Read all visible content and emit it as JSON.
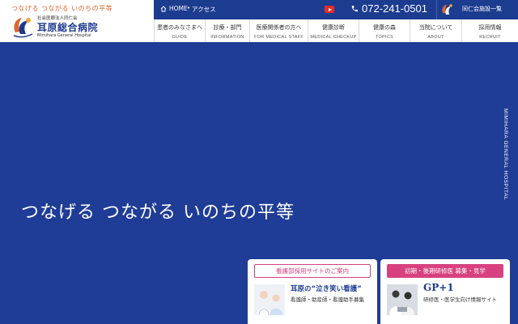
{
  "header": {
    "tagline": "つなげる つながる いのちの平等",
    "corp_name": "社会医療法人同仁会",
    "hospital_name": "耳原総合病院",
    "hospital_name_en": "Mimihara General Hospital"
  },
  "topbar": {
    "home_label": "HOME",
    "access_label": "アクセス",
    "phone": "072-241-0501",
    "group_label": "同仁会施設一覧"
  },
  "nav": [
    {
      "jp": "患者のみなさまへ",
      "en": "GUIDE"
    },
    {
      "jp": "診療・部門",
      "en": "INFORMATION"
    },
    {
      "jp": "医療関係者の方へ",
      "en": "FOR MEDICAL STAFF"
    },
    {
      "jp": "健康診断",
      "en": "MEDICAL CHECKUP"
    },
    {
      "jp": "健康の森",
      "en": "TOPICS"
    },
    {
      "jp": "当院について",
      "en": "ABOUT"
    },
    {
      "jp": "採用情報",
      "en": "RECRUIT"
    }
  ],
  "hero": {
    "title": "つなげる つながる いのちの平等",
    "vertical_label": "MIMIHARA GENERAL HOSPITAL"
  },
  "banners": {
    "nursing": {
      "head": "看護部採用サイトのご案内",
      "title": "耳原の“泣き笑い看護”",
      "sub": "看護師・助産師・看護助手募集"
    },
    "resident": {
      "head": "初期・後期研修医 募集・見学",
      "title": "GP+1",
      "sub": "研修医・医学生向け情報サイト"
    }
  },
  "colors": {
    "brand_blue": "#1f3c96",
    "accent_orange": "#e0662f",
    "accent_pink": "#d7417f"
  }
}
